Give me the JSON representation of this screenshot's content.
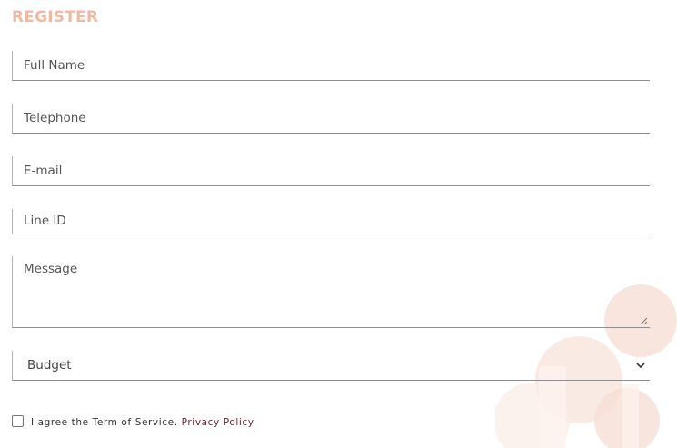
{
  "form": {
    "title": "REGISTER",
    "fields": {
      "full_name": "Full Name",
      "telephone": "Telephone",
      "email": "E-mail",
      "line_id": "Line ID",
      "message": "Message",
      "budget": "Budget"
    },
    "agree": {
      "text": "I agree the Term of Service.",
      "link": "Privacy Policy"
    }
  },
  "colors": {
    "title": "#f1b9a3",
    "decor": "#f6ded4",
    "link": "#6b1f2a"
  }
}
